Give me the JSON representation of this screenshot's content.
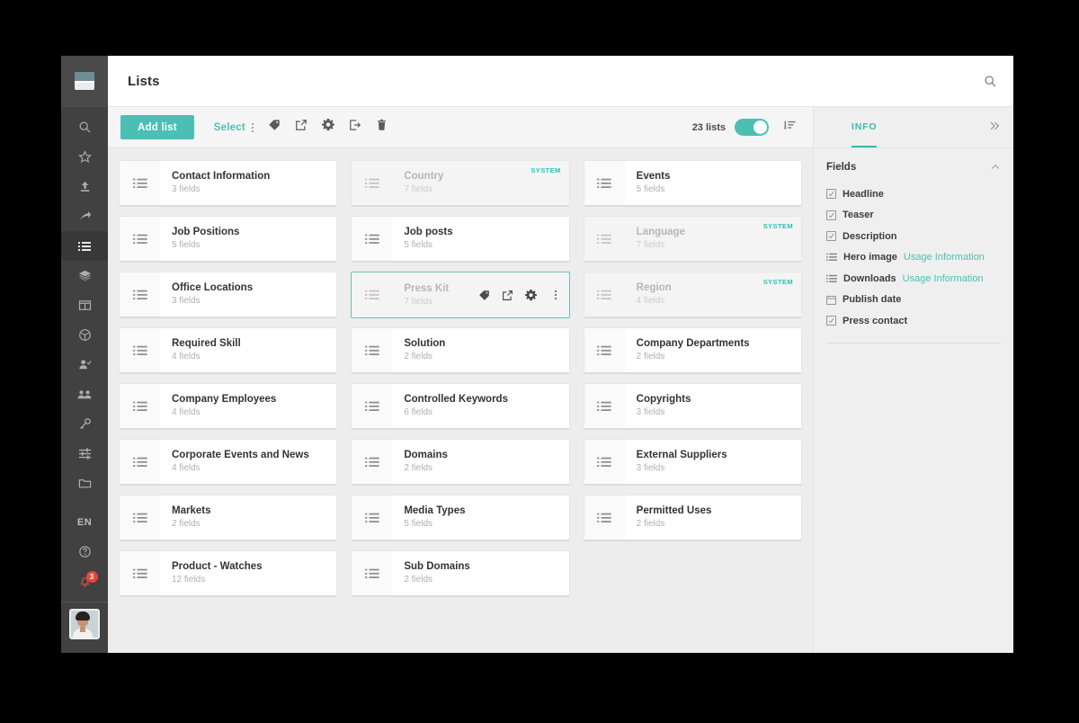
{
  "sidebar": {
    "logo_name": "app-logo",
    "items": [
      {
        "name": "search",
        "icon": "search-icon",
        "active": false
      },
      {
        "name": "favorites",
        "icon": "star-icon",
        "active": false
      },
      {
        "name": "upload",
        "icon": "upload-icon",
        "active": false
      },
      {
        "name": "share",
        "icon": "share-icon",
        "active": false
      },
      {
        "name": "lists",
        "icon": "list-icon",
        "active": true
      },
      {
        "name": "layers",
        "icon": "layers-icon",
        "active": false
      },
      {
        "name": "dashboard",
        "icon": "dashboard-icon",
        "active": false
      },
      {
        "name": "cube",
        "icon": "cube-icon",
        "active": false
      },
      {
        "name": "user-check",
        "icon": "user-check-icon",
        "active": false
      },
      {
        "name": "groups",
        "icon": "users-icon",
        "active": false
      },
      {
        "name": "keys",
        "icon": "key-icon",
        "active": false
      },
      {
        "name": "settings-sliders",
        "icon": "sliders-icon",
        "active": false
      },
      {
        "name": "folders",
        "icon": "folder-icon",
        "active": false
      }
    ],
    "language": "EN",
    "help_icon": "help-icon",
    "notifications": {
      "icon": "bell-icon",
      "count": "3"
    },
    "avatar_label": "user-avatar"
  },
  "header": {
    "title": "Lists",
    "search_icon": "search-icon"
  },
  "toolbar": {
    "add_label": "Add list",
    "select_label": "Select",
    "kebab_icon": "more-options-icon",
    "icons": [
      {
        "name": "tag-icon"
      },
      {
        "name": "export-open-icon"
      },
      {
        "name": "settings-gear-icon"
      },
      {
        "name": "logout-export-icon"
      },
      {
        "name": "delete-trash-icon"
      }
    ],
    "count_label": "23 lists",
    "toggle_on": true,
    "sort_icon": "sort-icon"
  },
  "cards": [
    {
      "title": "Contact Information",
      "fields": "3 fields",
      "state": "normal",
      "badge": ""
    },
    {
      "title": "Country",
      "fields": "7 fields",
      "state": "system",
      "badge": "SYSTEM"
    },
    {
      "title": "Events",
      "fields": "5 fields",
      "state": "normal",
      "badge": ""
    },
    {
      "title": "Job Positions",
      "fields": "5 fields",
      "state": "normal",
      "badge": ""
    },
    {
      "title": "Job posts",
      "fields": "5 fields",
      "state": "normal",
      "badge": ""
    },
    {
      "title": "Language",
      "fields": "7 fields",
      "state": "system",
      "badge": "SYSTEM"
    },
    {
      "title": "Office Locations",
      "fields": "3 fields",
      "state": "normal",
      "badge": ""
    },
    {
      "title": "Press Kit",
      "fields": "7 fields",
      "state": "selected",
      "badge": ""
    },
    {
      "title": "Region",
      "fields": "4 fields",
      "state": "system",
      "badge": "SYSTEM"
    },
    {
      "title": "Required Skill",
      "fields": "4 fields",
      "state": "normal",
      "badge": ""
    },
    {
      "title": "Solution",
      "fields": "2 fields",
      "state": "normal",
      "badge": ""
    },
    {
      "title": "Company Departments",
      "fields": "2 fields",
      "state": "normal",
      "badge": ""
    },
    {
      "title": "Company Employees",
      "fields": "4 fields",
      "state": "normal",
      "badge": ""
    },
    {
      "title": "Controlled Keywords",
      "fields": "6 fields",
      "state": "normal",
      "badge": ""
    },
    {
      "title": "Copyrights",
      "fields": "3 fields",
      "state": "normal",
      "badge": ""
    },
    {
      "title": "Corporate Events and News",
      "fields": "4 fields",
      "state": "normal",
      "badge": ""
    },
    {
      "title": "Domains",
      "fields": "2 fields",
      "state": "normal",
      "badge": ""
    },
    {
      "title": "External Suppliers",
      "fields": "3 fields",
      "state": "normal",
      "badge": ""
    },
    {
      "title": "Markets",
      "fields": "2 fields",
      "state": "normal",
      "badge": ""
    },
    {
      "title": "Media Types",
      "fields": "5 fields",
      "state": "normal",
      "badge": ""
    },
    {
      "title": "Permitted Uses",
      "fields": "2 fields",
      "state": "normal",
      "badge": ""
    },
    {
      "title": "Product - Watches",
      "fields": "12 fields",
      "state": "normal",
      "badge": ""
    },
    {
      "title": "Sub Domains",
      "fields": "2 fields",
      "state": "normal",
      "badge": ""
    }
  ],
  "card_actions": [
    {
      "name": "tag-icon"
    },
    {
      "name": "export-open-icon"
    },
    {
      "name": "settings-gear-icon"
    },
    {
      "name": "more-options-icon"
    }
  ],
  "info_panel": {
    "tab_label": "INFO",
    "collapse_icon": "collapse-right-icon",
    "section_label": "Fields",
    "section_chevron": "chevron-up-icon",
    "fields": [
      {
        "label": "Headline",
        "icon": "text-field-icon",
        "link": ""
      },
      {
        "label": "Teaser",
        "icon": "text-field-icon",
        "link": ""
      },
      {
        "label": "Description",
        "icon": "text-field-icon",
        "link": ""
      },
      {
        "label": "Hero image",
        "icon": "list-field-icon",
        "link": "Usage Information"
      },
      {
        "label": "Downloads",
        "icon": "list-field-icon",
        "link": "Usage Information"
      },
      {
        "label": "Publish date",
        "icon": "calendar-icon",
        "link": ""
      },
      {
        "label": "Press contact",
        "icon": "text-field-icon",
        "link": ""
      }
    ]
  },
  "colors": {
    "accent_teal": "#4CBFB5",
    "badge_teal": "#2FC0B5",
    "notification_red": "#E8453C",
    "sidebar_dark": "#414141",
    "page_bg": "#EDEDED"
  }
}
